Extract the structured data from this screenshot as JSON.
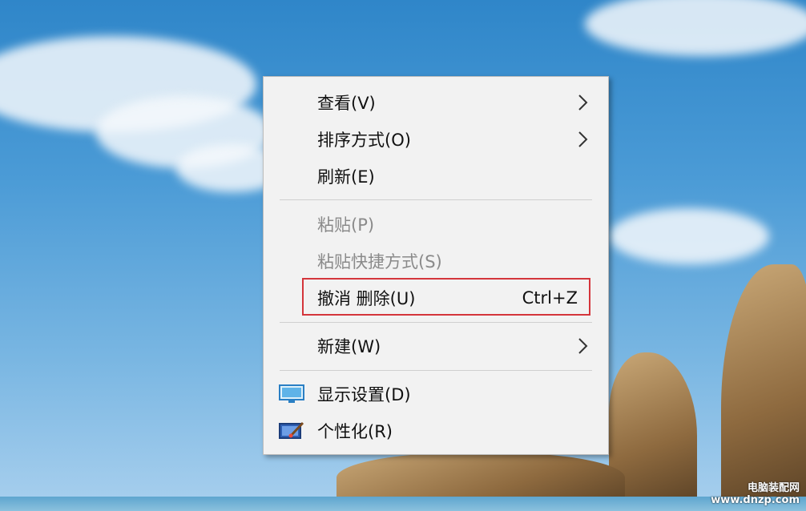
{
  "context_menu": {
    "items": [
      {
        "label": "查看(V)",
        "has_submenu": true,
        "enabled": true
      },
      {
        "label": "排序方式(O)",
        "has_submenu": true,
        "enabled": true
      },
      {
        "label": "刷新(E)",
        "has_submenu": false,
        "enabled": true
      },
      {
        "label": "粘贴(P)",
        "has_submenu": false,
        "enabled": false
      },
      {
        "label": "粘贴快捷方式(S)",
        "has_submenu": false,
        "enabled": false
      },
      {
        "label": "撤消 删除(U)",
        "shortcut": "Ctrl+Z",
        "has_submenu": false,
        "enabled": true,
        "highlighted": true
      },
      {
        "label": "新建(W)",
        "has_submenu": true,
        "enabled": true
      },
      {
        "label": "显示设置(D)",
        "icon": "display-settings-icon",
        "enabled": true
      },
      {
        "label": "个性化(R)",
        "icon": "personalize-icon",
        "enabled": true
      }
    ]
  },
  "watermark": {
    "line1": "电脑装配网",
    "line2": "www.dnzp.com"
  },
  "colors": {
    "highlight_border": "#d4353b",
    "menu_background": "#f2f2f2",
    "disabled_text": "#8a8a8a"
  }
}
